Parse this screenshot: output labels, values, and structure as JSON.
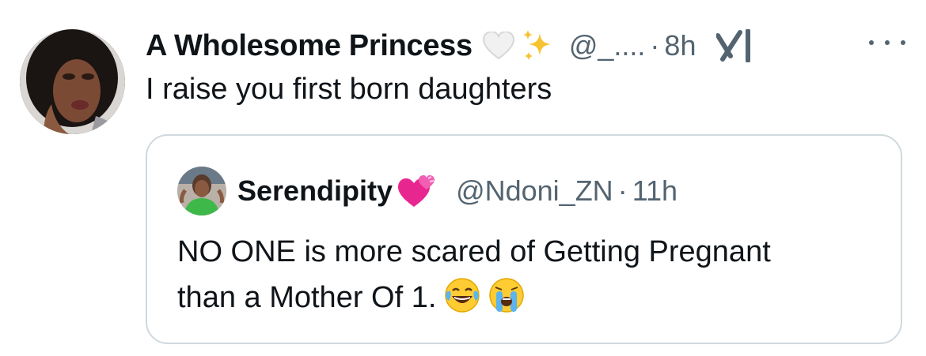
{
  "tweet": {
    "author_name": "A Wholesome Princess",
    "handle": "@_....",
    "separator": "·",
    "time": "8h",
    "text": "I raise you first born daughters",
    "icons": [
      "white-heart-icon",
      "sparkles-icon",
      "grok-icon",
      "more-icon"
    ]
  },
  "quote": {
    "author_name": "Serendipity",
    "handle": "@Ndoni_ZN",
    "separator": "·",
    "time": "11h",
    "text_line1": "NO ONE is more scared of Getting Pregnant",
    "text_line2": "than a Mother Of 1.",
    "icons": [
      "two-hearts-icon",
      "laughing-tears-icon",
      "crying-face-icon"
    ]
  },
  "colors": {
    "text_primary": "#0f1419",
    "text_secondary": "#536471",
    "border": "#cfd9de"
  }
}
